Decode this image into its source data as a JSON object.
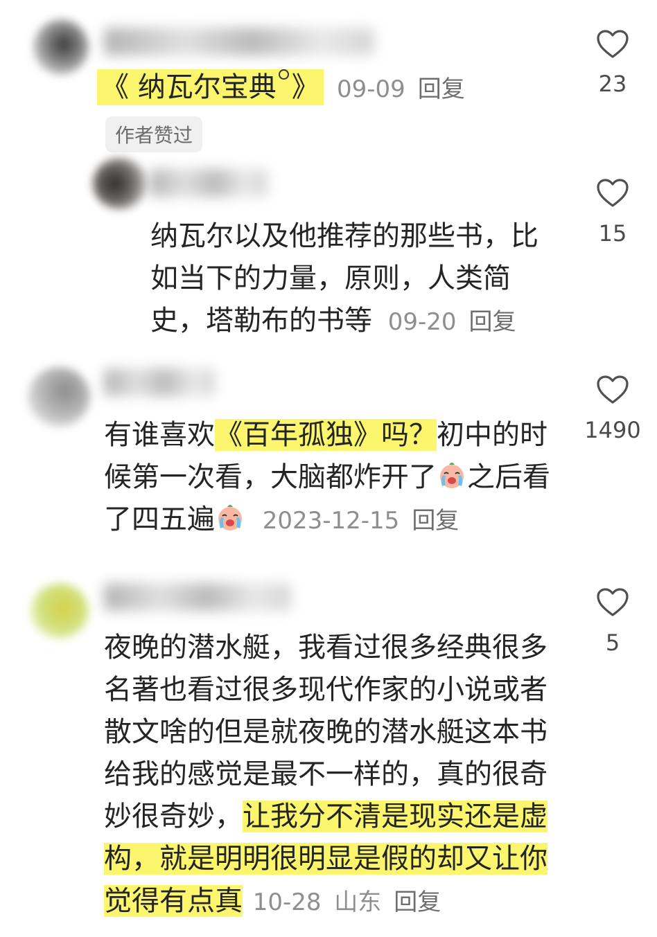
{
  "comments": [
    {
      "book_link": "《 纳瓦尔宝典",
      "book_link_end": "》",
      "date": "09-09",
      "reply": "回复",
      "badge": "作者赞过",
      "likes": "23"
    },
    {
      "lines": [
        "纳瓦尔以及他推荐的那些书，比",
        "如当下的力量，原则，人类简",
        "史，塔勒布的书等"
      ],
      "date": "09-20",
      "reply": "回复",
      "likes": "15"
    },
    {
      "line1_pre": "有谁喜欢",
      "line1_hl": "《百年孤独》吗？",
      "line1_post": "初中的时",
      "line2_pre": "候第一次看，大脑都炸开了",
      "line2_post": "之后看",
      "line3_pre": "了四五遍",
      "date": "2023-12-15",
      "reply": "回复",
      "likes": "1490",
      "emoji": "crying-face"
    },
    {
      "lines": [
        "夜晚的潜水艇，我看过很多经典很多",
        "名著也看过很多现代作家的小说或者",
        "散文啥的但是就夜晚的潜水艇这本书",
        "给我的感觉是最不一样的，真的很奇"
      ],
      "line5_pre": "妙很奇妙，",
      "line5_hl": "让我分不清是现实还是虚",
      "line6_hl": "构，就是明明很明显是假的却又让你",
      "line7_hl": "觉得有点真",
      "date": "10-28",
      "location": "山东",
      "reply": "回复",
      "likes": "5"
    }
  ],
  "colors": {
    "highlight": "#fbf66e",
    "meta": "#8e8e8e",
    "text": "#242424"
  },
  "icons": {
    "like": "heart-outline-icon",
    "emoji": "crying-face-icon"
  }
}
